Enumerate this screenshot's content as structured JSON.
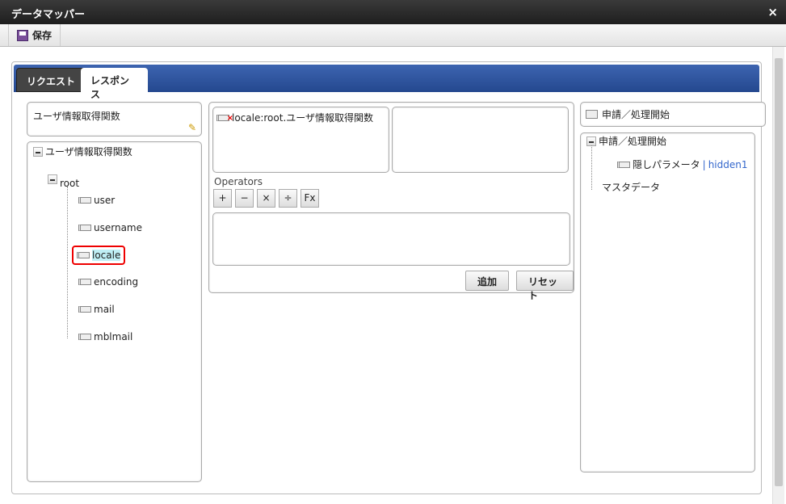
{
  "window": {
    "title": "データマッパー",
    "close_icon": "×"
  },
  "toolbar": {
    "save_label": "保存"
  },
  "tabs": [
    {
      "label": "リクエスト"
    },
    {
      "label": "レスポンス",
      "active": true
    }
  ],
  "left": {
    "function_name": "ユーザ情報取得関数",
    "tree": {
      "root_label": "ユーザ情報取得関数",
      "child": "root",
      "items": [
        "user",
        "username",
        "locale",
        "encoding",
        "mail",
        "mblmail"
      ],
      "selected": "locale"
    }
  },
  "middle": {
    "source_item": "locale:root.ユーザ情報取得関数",
    "operators_label": "Operators",
    "operators": [
      "+",
      "−",
      "×",
      "÷",
      "Fx"
    ],
    "add_label": "追加",
    "reset_label": "リセット"
  },
  "right": {
    "header": "申請／処理開始",
    "tree": {
      "root_label": "申請／処理開始",
      "child_name": "隠しパラメータ",
      "child_id": "hidden1",
      "separator": " | ",
      "sibling": "マスタデータ"
    }
  }
}
